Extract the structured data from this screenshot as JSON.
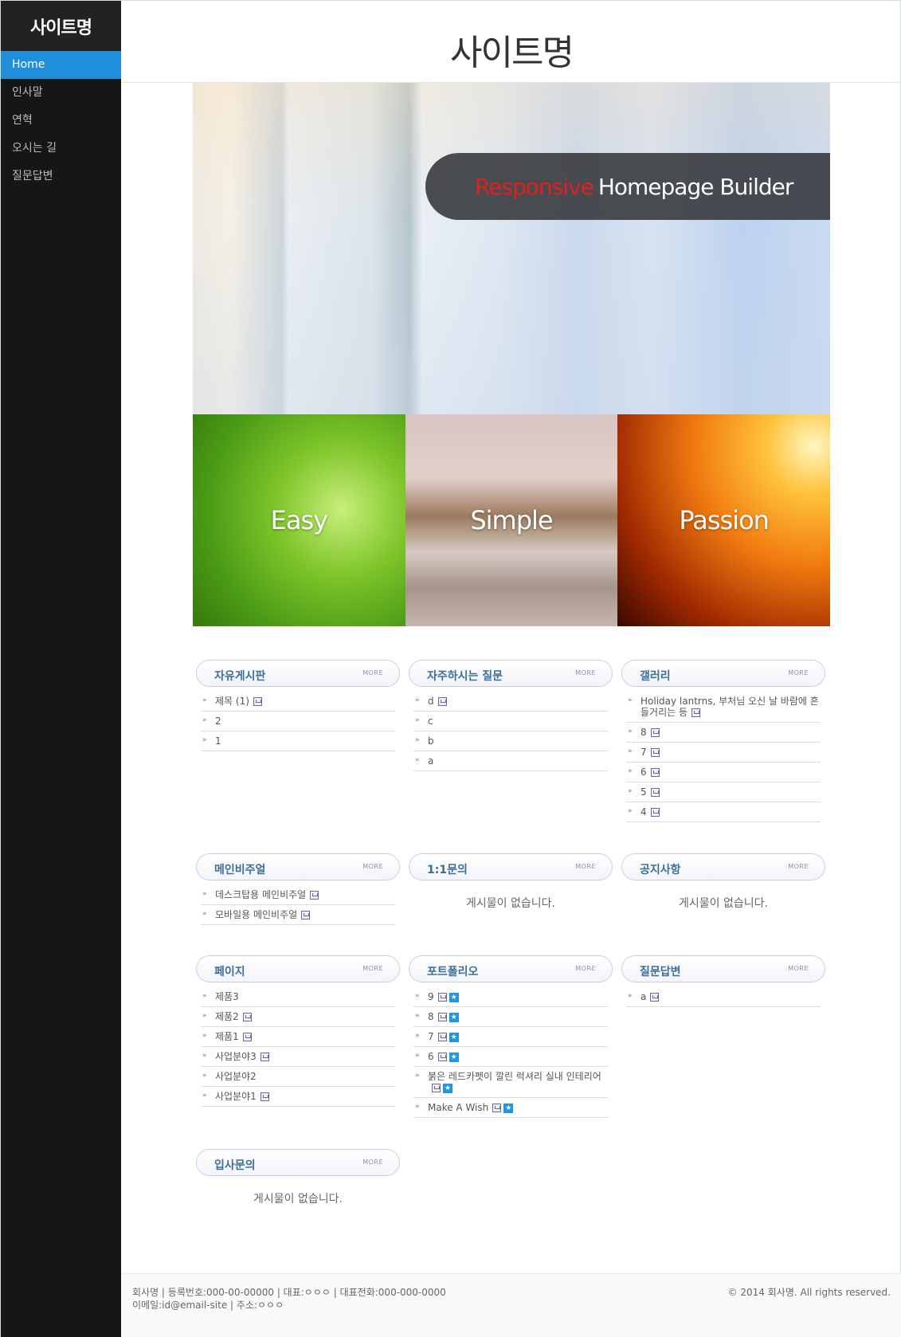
{
  "sidebar": {
    "logo": "사이트명",
    "items": [
      {
        "label": "Home"
      },
      {
        "label": "인사말"
      },
      {
        "label": "연혁"
      },
      {
        "label": "오시는 길"
      },
      {
        "label": "질문답변"
      }
    ]
  },
  "header": {
    "title": "사이트명"
  },
  "hero": {
    "accent": "Responsive",
    "title": "Homepage Builder"
  },
  "tiles": [
    {
      "label": "Easy"
    },
    {
      "label": "Simple"
    },
    {
      "label": "Passion"
    }
  ],
  "more_label": "MORE",
  "boards": {
    "free": {
      "title": "자유게시판",
      "items": [
        "제목 (1)",
        "2",
        "1"
      ]
    },
    "faq": {
      "title": "자주하시는 질문",
      "items": [
        "d",
        "c",
        "b",
        "a"
      ]
    },
    "gallery": {
      "title": "갤러리",
      "items": [
        "Holiday lantrns, 부처님 오신 날 바람에 흔들거리는 등",
        "8",
        "7",
        "6",
        "5",
        "4"
      ]
    },
    "mainvisual": {
      "title": "메인비주얼",
      "items": [
        "데스크탑용 메인비주얼",
        "모바일용 메인비주얼"
      ]
    },
    "inquiry": {
      "title": "1:1문의",
      "empty": "게시물이 없습니다."
    },
    "notice": {
      "title": "공지사항",
      "empty": "게시물이 없습니다."
    },
    "page": {
      "title": "페이지",
      "items": [
        "제품3",
        "제품2",
        "제품1",
        "사업분야3",
        "사업분야2",
        "사업분야1"
      ]
    },
    "portfolio": {
      "title": "포트폴리오",
      "items": [
        "9",
        "8",
        "7",
        "6",
        "붉은 레드카펫이 깔린 럭셔리 실내 인테리어",
        "Make A Wish"
      ]
    },
    "qna": {
      "title": "질문답변",
      "items": [
        "a"
      ]
    },
    "recruit": {
      "title": "입사문의",
      "empty": "게시물이 없습니다."
    }
  },
  "footer": {
    "line1": "회사명 | 등록번호:000-00-00000 | 대표:ㅇㅇㅇ | 대표전화:000-000-0000",
    "line2": "이메일:id@email-site | 주소:ㅇㅇㅇ",
    "copyright": "© 2014 회사명. All rights reserved."
  }
}
